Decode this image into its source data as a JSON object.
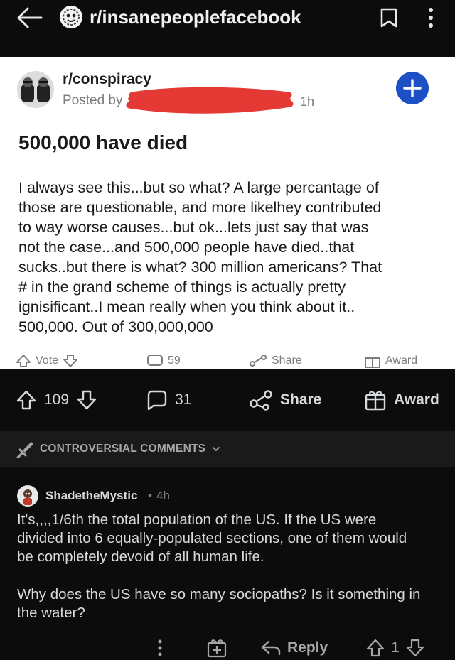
{
  "header": {
    "subreddit": "r/insanepeoplefacebook",
    "icons": {
      "back": "arrow-left-icon",
      "subreddit": "subreddit-avatar-icon",
      "save": "bookmark-icon",
      "more": "more-vertical-icon"
    }
  },
  "screenshot": {
    "subreddit": "r/conspiracy",
    "posted_by_label": "Posted by",
    "age": "1h",
    "title": "500,000 have died",
    "body_lines": [
      "I always see this...but so what? A large percantage of",
      "those are questionable, and more likelhey contributed",
      "to way worse causes...but ok...lets just say that was",
      "not the case...and 500,000 people have died..that",
      "sucks..but there is what? 300 million americans? That",
      "# in the grand scheme of things is actually pretty",
      "ignisificant..I mean really when you think about it..",
      "500,000. Out of 300,000,000"
    ],
    "actions": {
      "vote": "Vote",
      "comments": "59",
      "share": "Share",
      "award": "Award"
    },
    "redaction_color": "#e53935",
    "join_color": "#1d4fc7"
  },
  "post_actions": {
    "score": "109",
    "comments": "31",
    "share": "Share",
    "award": "Award"
  },
  "sort": {
    "label": "CONTROVERSIAL COMMENTS",
    "icon": "sword-icon"
  },
  "comment": {
    "username": "ShadetheMystic",
    "separator": "•",
    "age": "4h",
    "paragraph1_lines": [
      "It's,,,,1/6th the total population of the US. If the US were",
      "divided into 6 equally-populated sections, one of them would",
      "be completely devoid of all human life."
    ],
    "paragraph2_lines": [
      "Why does the US have so many sociopaths? Is it something in",
      "the water?"
    ],
    "reply_label": "Reply",
    "score": "1"
  },
  "colors": {
    "background": "#0c0c0d",
    "surface": "#1a1a1b",
    "text": "#d7dadc",
    "muted": "#818384"
  }
}
